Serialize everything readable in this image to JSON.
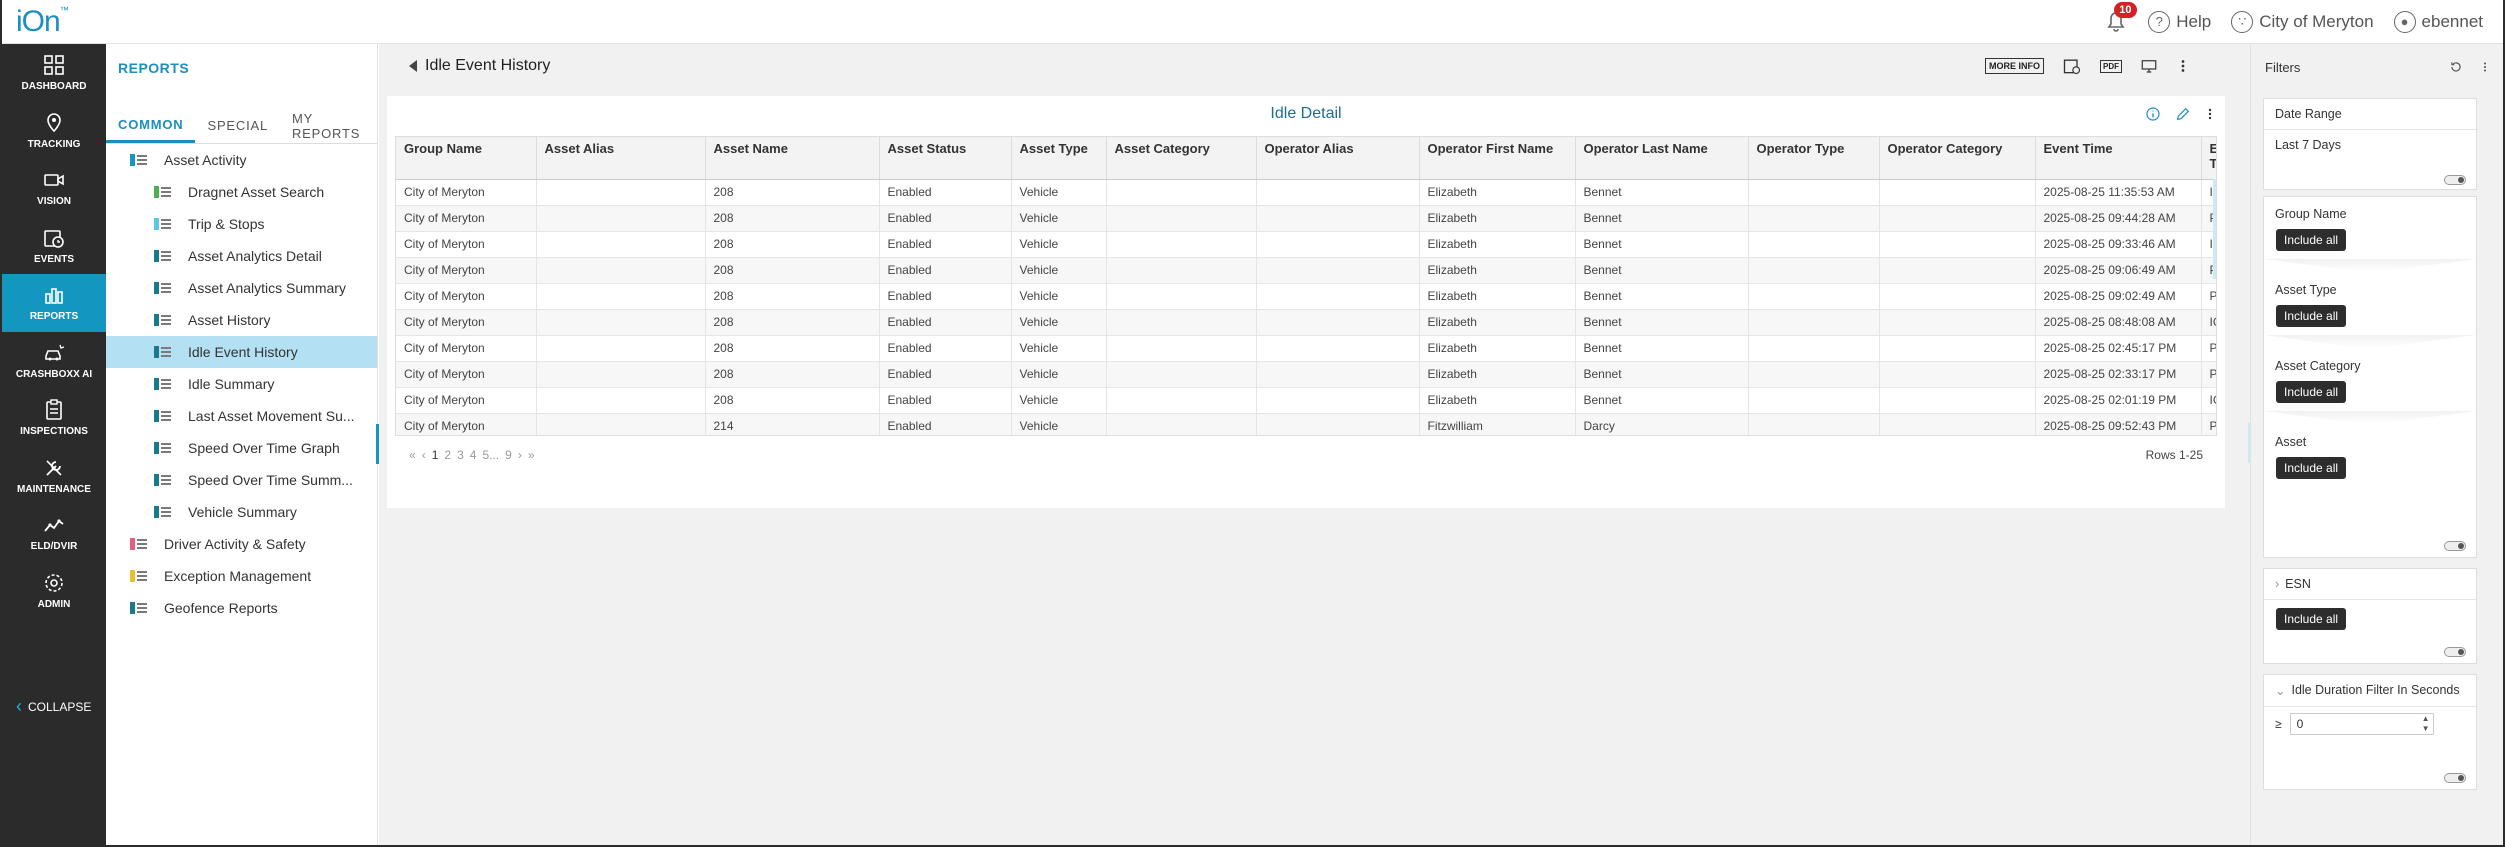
{
  "app": {
    "logo": "iOn",
    "logo_tm": "™"
  },
  "topbar": {
    "notifications_count": "10",
    "help_label": "Help",
    "org_label": "City of Meryton",
    "user_label": "ebennet"
  },
  "nav": {
    "items": [
      {
        "label": "DASHBOARD",
        "icon": "dashboard-icon"
      },
      {
        "label": "TRACKING",
        "icon": "location-pin-icon"
      },
      {
        "label": "VISION",
        "icon": "video-camera-icon"
      },
      {
        "label": "EVENTS",
        "icon": "calendar-clock-icon"
      },
      {
        "label": "REPORTS",
        "icon": "bar-chart-icon"
      },
      {
        "label": "CRASHBOXX AI",
        "icon": "crash-car-icon"
      },
      {
        "label": "INSPECTIONS",
        "icon": "clipboard-icon"
      },
      {
        "label": "MAINTENANCE",
        "icon": "wrench-icon"
      },
      {
        "label": "ELD/DVIR",
        "icon": "route-icon"
      },
      {
        "label": "ADMIN",
        "icon": "gear-icon"
      }
    ],
    "collapse_label": "COLLAPSE"
  },
  "reports": {
    "title": "REPORTS",
    "tabs": [
      "COMMON",
      "SPECIAL",
      "MY REPORTS"
    ],
    "tree": [
      {
        "label": "Asset Activity",
        "level": 0,
        "color": "#1397c1"
      },
      {
        "label": "Dragnet Asset Search",
        "level": 1,
        "color": "#4caf50"
      },
      {
        "label": "Trip & Stops",
        "level": 1,
        "color": "#5cc6e8"
      },
      {
        "label": "Asset Analytics Detail",
        "level": 1,
        "color": "#1a7a8c"
      },
      {
        "label": "Asset Analytics Summary",
        "level": 1,
        "color": "#1a7a8c"
      },
      {
        "label": "Asset History",
        "level": 1,
        "color": "#1a7a8c"
      },
      {
        "label": "Idle Event History",
        "level": 1,
        "color": "#1a7a8c"
      },
      {
        "label": "Idle Summary",
        "level": 1,
        "color": "#1a7a8c"
      },
      {
        "label": "Last Asset Movement Su...",
        "level": 1,
        "color": "#1a7a8c"
      },
      {
        "label": "Speed Over Time Graph",
        "level": 1,
        "color": "#1a7a8c"
      },
      {
        "label": "Speed Over Time Summ...",
        "level": 1,
        "color": "#1a7a8c"
      },
      {
        "label": "Vehicle Summary",
        "level": 1,
        "color": "#1a7a8c"
      },
      {
        "label": "Driver Activity & Safety",
        "level": 0,
        "color": "#e0607e"
      },
      {
        "label": "Exception Management",
        "level": 0,
        "color": "#e8c22c"
      },
      {
        "label": "Geofence Reports",
        "level": 0,
        "color": "#1a7a8c"
      }
    ]
  },
  "main": {
    "title": "Idle Event History",
    "more_info": "MORE INFO",
    "pdf": "PDF",
    "card_title": "Idle Detail",
    "columns": [
      "Group Name",
      "Asset Alias",
      "Asset Name",
      "Asset Status",
      "Asset Type",
      "Asset Category",
      "Operator Alias",
      "Operator First Name",
      "Operator Last Name",
      "Operator Type",
      "Operator Category",
      "Event Time",
      "Event Typ"
    ],
    "rows": [
      [
        "City of Meryton",
        "",
        "208",
        "Enabled",
        "Vehicle",
        "",
        "",
        "Elizabeth",
        "Bennet",
        "",
        "",
        "2025-08-25 11:35:53 AM",
        "IGO"
      ],
      [
        "City of Meryton",
        "",
        "208",
        "Enabled",
        "Vehicle",
        "",
        "",
        "Elizabeth",
        "Bennet",
        "",
        "",
        "2025-08-25 09:44:28 AM",
        "PR"
      ],
      [
        "City of Meryton",
        "",
        "208",
        "Enabled",
        "Vehicle",
        "",
        "",
        "Elizabeth",
        "Bennet",
        "",
        "",
        "2025-08-25 09:33:46 AM",
        "IGO"
      ],
      [
        "City of Meryton",
        "",
        "208",
        "Enabled",
        "Vehicle",
        "",
        "",
        "Elizabeth",
        "Bennet",
        "",
        "",
        "2025-08-25 09:06:49 AM",
        "PR"
      ],
      [
        "City of Meryton",
        "",
        "208",
        "Enabled",
        "Vehicle",
        "",
        "",
        "Elizabeth",
        "Bennet",
        "",
        "",
        "2025-08-25 09:02:49 AM",
        "PR"
      ],
      [
        "City of Meryton",
        "",
        "208",
        "Enabled",
        "Vehicle",
        "",
        "",
        "Elizabeth",
        "Bennet",
        "",
        "",
        "2025-08-25 08:48:08 AM",
        "IGO"
      ],
      [
        "City of Meryton",
        "",
        "208",
        "Enabled",
        "Vehicle",
        "",
        "",
        "Elizabeth",
        "Bennet",
        "",
        "",
        "2025-08-25 02:45:17 PM",
        "PR"
      ],
      [
        "City of Meryton",
        "",
        "208",
        "Enabled",
        "Vehicle",
        "",
        "",
        "Elizabeth",
        "Bennet",
        "",
        "",
        "2025-08-25 02:33:17 PM",
        "PR"
      ],
      [
        "City of Meryton",
        "",
        "208",
        "Enabled",
        "Vehicle",
        "",
        "",
        "Elizabeth",
        "Bennet",
        "",
        "",
        "2025-08-25 02:01:19 PM",
        "IGO"
      ],
      [
        "City of Meryton",
        "",
        "214",
        "Enabled",
        "Vehicle",
        "",
        "",
        "Fitzwilliam",
        "Darcy",
        "",
        "",
        "2025-08-25 09:52:43 PM",
        "PR"
      ]
    ],
    "pager": [
      "«",
      "‹",
      "1",
      "2",
      "3",
      "4",
      "5...",
      "9",
      "›",
      "»"
    ],
    "rows_label": "Rows 1-25"
  },
  "filters": {
    "title": "Filters",
    "date_range_label": "Date Range",
    "date_range_value": "Last 7 Days",
    "groups": [
      "Group Name",
      "Asset Type",
      "Asset Category",
      "Asset"
    ],
    "include_all": "Include all",
    "esn_label": "ESN",
    "idle_label": "Idle Duration Filter In Seconds",
    "idle_operator": "≥",
    "idle_value": "0"
  }
}
